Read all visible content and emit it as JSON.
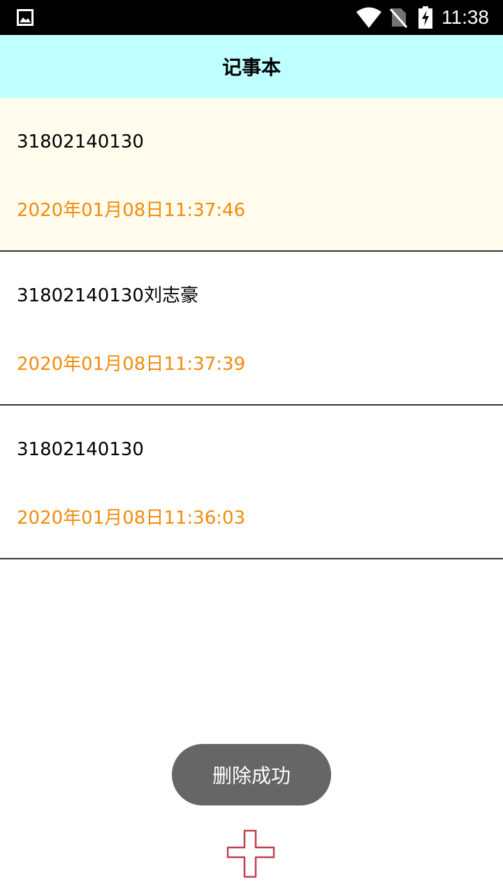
{
  "status_bar": {
    "time": "11:38",
    "icons": [
      "gallery-icon",
      "wifi-icon",
      "no-sim-icon",
      "battery-charging-icon"
    ]
  },
  "app": {
    "title": "记事本"
  },
  "notes": [
    {
      "title": "31802140130",
      "time": "2020年01月08日11:37:46"
    },
    {
      "title": "31802140130刘志豪",
      "time": "2020年01月08日11:37:39"
    },
    {
      "title": "31802140130",
      "time": "2020年01月08日11:36:03"
    }
  ],
  "toast": {
    "message": "删除成功"
  },
  "fab": {
    "icon": "plus-icon",
    "color": "#c04050"
  },
  "colors": {
    "appbar": "#bfffff",
    "highlight_row": "#fffcee",
    "timestamp": "#f48a0c"
  }
}
